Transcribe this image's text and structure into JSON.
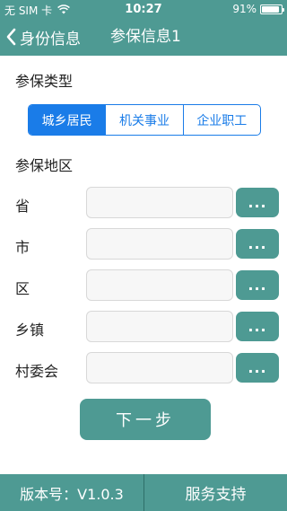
{
  "status_bar": {
    "carrier": "无 SIM 卡",
    "time": "10:27",
    "battery_percent": "91%",
    "battery_level": 0.91
  },
  "nav": {
    "back_label": "身份信息",
    "title": "参保信息1"
  },
  "insurance_type": {
    "title": "参保类型",
    "options": [
      "城乡居民",
      "机关事业",
      "企业职工"
    ],
    "selected": "城乡居民"
  },
  "region": {
    "title": "参保地区",
    "rows": [
      {
        "label": "省",
        "value": "",
        "button": "..."
      },
      {
        "label": "市",
        "value": "",
        "button": "..."
      },
      {
        "label": "区",
        "value": "",
        "button": "..."
      },
      {
        "label": "乡镇",
        "value": "",
        "button": "..."
      },
      {
        "label": "村委会",
        "value": "",
        "button": "..."
      }
    ]
  },
  "next_button": "下一步",
  "footer": {
    "version": "版本号：V1.0.3",
    "support": "服务支持"
  },
  "colors": {
    "primary": "#4e9a93",
    "segment_accent": "#1a7ce8"
  }
}
